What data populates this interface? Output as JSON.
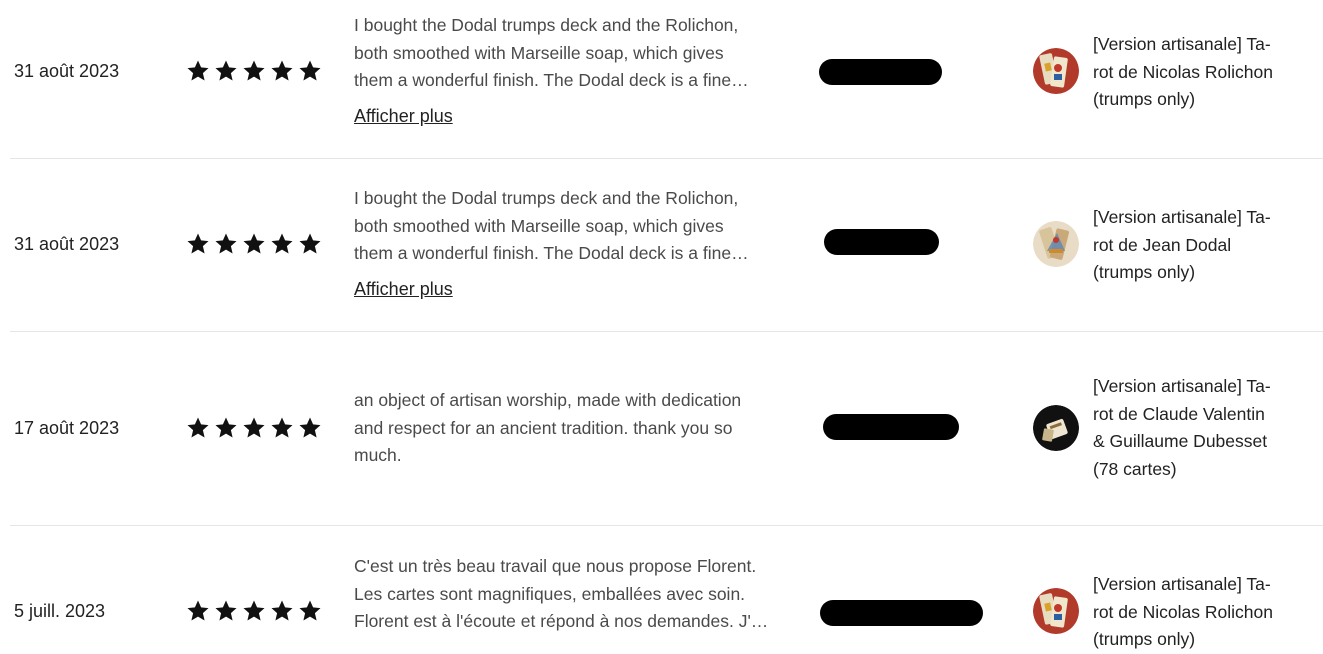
{
  "reviews": [
    {
      "date": "31 août 2023",
      "rating": 5,
      "text_lines": [
        "I bought the Dodal trumps deck and the Rolichon,",
        "both smoothed with Marseille soap, which gives",
        "them a wonderful finish. The Dodal deck is a fine…"
      ],
      "show_more": "Afficher plus",
      "product_lines": [
        "[Version artisanale] Ta-",
        "rot de Nicolas Rolichon",
        "(trumps only)"
      ],
      "thumb_icon": "tarot-card-thumbnail-icon"
    },
    {
      "date": "31 août 2023",
      "rating": 5,
      "text_lines": [
        "I bought the Dodal trumps deck and the Rolichon,",
        "both smoothed with Marseille soap, which gives",
        "them a wonderful finish. The Dodal deck is a fine…"
      ],
      "show_more": "Afficher plus",
      "product_lines": [
        "[Version artisanale] Ta-",
        "rot de Jean Dodal",
        "(trumps only)"
      ],
      "thumb_icon": "tarot-card-thumbnail-icon"
    },
    {
      "date": "17 août 2023",
      "rating": 5,
      "text_lines": [
        "an object of artisan worship, made with dedication",
        "and respect for an ancient tradition. thank you so",
        "much."
      ],
      "product_lines": [
        "[Version artisanale] Ta-",
        "rot de Claude Valentin",
        "& Guillaume Dubesset",
        "(78 cartes)"
      ],
      "thumb_icon": "tarot-deck-box-thumbnail-icon"
    },
    {
      "date": "5 juill. 2023",
      "rating": 5,
      "text_lines": [
        "C'est un très beau travail que nous propose Florent.",
        "Les cartes sont magnifiques, emballées avec soin.",
        "Florent est à l'écoute et répond à nos demandes. J'…"
      ],
      "product_lines": [
        "[Version artisanale] Ta-",
        "rot de Nicolas Rolichon",
        "(trumps only)"
      ],
      "thumb_icon": "tarot-card-thumbnail-icon"
    }
  ],
  "colors": {
    "star": "#111111",
    "redaction": "#000000",
    "divider": "#e6e6e6",
    "review_text": "#4a4a4a"
  }
}
